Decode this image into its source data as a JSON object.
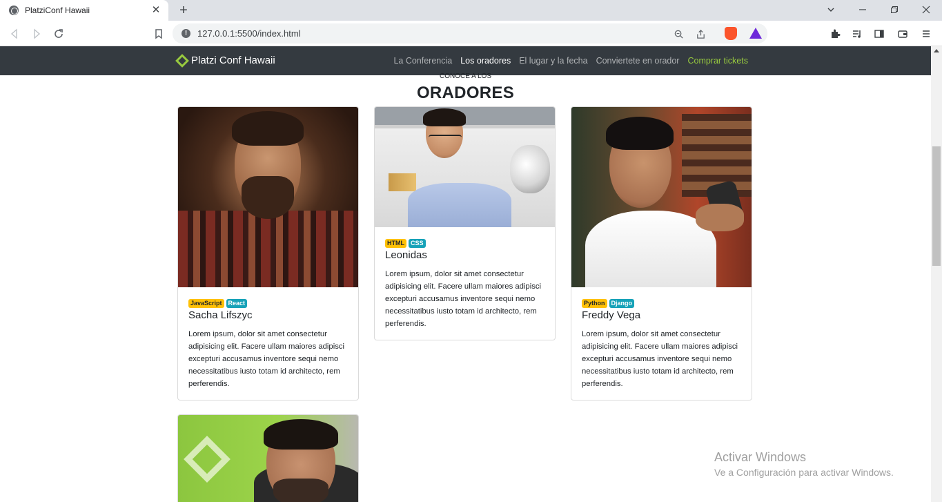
{
  "browser": {
    "tab_title": "PlatziConf Hawaii",
    "tab_close": "✕",
    "new_tab": "+",
    "url": "127.0.0.1:5500/index.html"
  },
  "navbar": {
    "brand": "Platzi Conf Hawaii",
    "links": [
      {
        "label": "La Conferencia"
      },
      {
        "label": "Los oradores"
      },
      {
        "label": "El lugar y la fecha"
      },
      {
        "label": "Conviertete en orador"
      },
      {
        "label": "Comprar tickets"
      }
    ]
  },
  "section": {
    "eyebrow": "CONOCE A LOS",
    "title": "ORADORES"
  },
  "speakers": [
    {
      "name": "Sacha Lifszyc",
      "badges": [
        {
          "label": "JavaScript",
          "variant": "warning"
        },
        {
          "label": "React",
          "variant": "info"
        }
      ],
      "bio": "Lorem ipsum, dolor sit amet consectetur adipisicing elit. Facere ullam maiores adipisci excepturi accusamus inventore sequi nemo necessitatibus iusto totam id architecto, rem perferendis."
    },
    {
      "name": "Leonidas",
      "badges": [
        {
          "label": "HTML",
          "variant": "warning"
        },
        {
          "label": "CSS",
          "variant": "info"
        }
      ],
      "bio": "Lorem ipsum, dolor sit amet consectetur adipisicing elit. Facere ullam maiores adipisci excepturi accusamus inventore sequi nemo necessitatibus iusto totam id architecto, rem perferendis."
    },
    {
      "name": "Freddy Vega",
      "badges": [
        {
          "label": "Python",
          "variant": "warning"
        },
        {
          "label": "Django",
          "variant": "info"
        }
      ],
      "bio": "Lorem ipsum, dolor sit amet consectetur adipisicing elit. Facere ullam maiores adipisci excepturi accusamus inventore sequi nemo necessitatibus iusto totam id architecto, rem perferendis."
    }
  ],
  "watermark": {
    "title": "Activar Windows",
    "subtitle": "Ve a Configuración para activar Windows."
  },
  "colors": {
    "navbar_bg": "#343a40",
    "brand_green": "#98ca3f",
    "badge_warning": "#ffc107",
    "badge_info": "#17a2b8"
  }
}
